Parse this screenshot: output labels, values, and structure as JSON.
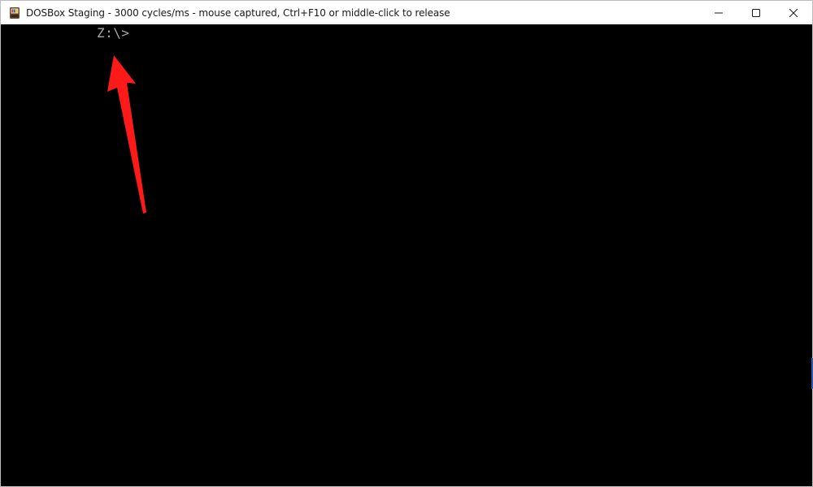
{
  "window": {
    "title": "DOSBox Staging - 3000 cycles/ms - mouse captured, Ctrl+F10 or middle-click to release",
    "app_icon": "dosbox-icon",
    "buttons": {
      "minimize": "minimize-icon",
      "maximize": "maximize-icon",
      "close": "close-icon"
    }
  },
  "console": {
    "prompt": "Z:\\>",
    "text_color": "#a8a8a8",
    "background": "#000000"
  },
  "annotation": {
    "arrow_color": "#ff1a1a",
    "points_to": "prompt"
  }
}
